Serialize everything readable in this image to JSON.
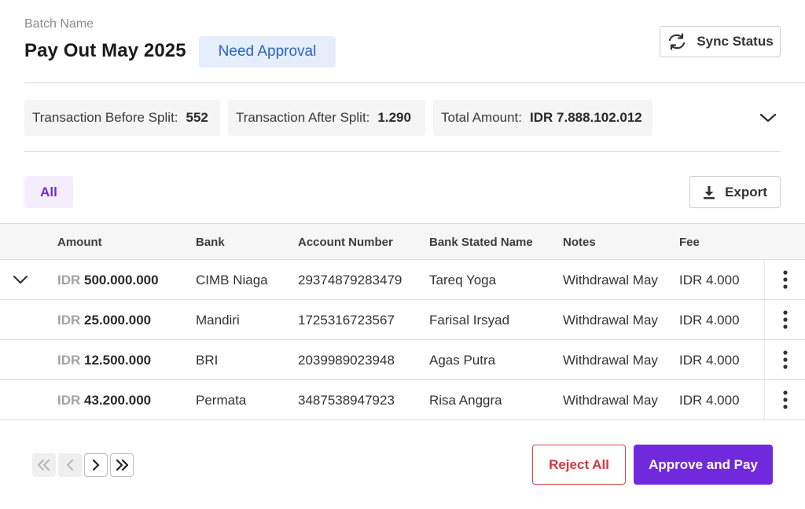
{
  "header": {
    "batch_label": "Batch Name",
    "batch_title": "Pay Out May 2025",
    "status": "Need Approval",
    "sync_label": "Sync Status"
  },
  "summary": {
    "before_label": "Transaction Before Split:",
    "before_value": "552",
    "after_label": "Transaction After Split:",
    "after_value": "1.290",
    "total_label": "Total Amount:",
    "total_value": "IDR 7.888.102.012"
  },
  "filters": {
    "all_label": "All",
    "export_label": "Export"
  },
  "table": {
    "columns": [
      "Amount",
      "Bank",
      "Account Number",
      "Bank Stated Name",
      "Notes",
      "Fee"
    ],
    "rows": [
      {
        "currency": "IDR",
        "amount": "500.000.000",
        "bank": "CIMB Niaga",
        "account": "29374879283479",
        "name": "Tareq Yoga",
        "notes": "Withdrawal May",
        "fee": "IDR 4.000"
      },
      {
        "currency": "IDR",
        "amount": "25.000.000",
        "bank": "Mandiri",
        "account": "1725316723567",
        "name": "Farisal Irsyad",
        "notes": "Withdrawal May",
        "fee": "IDR 4.000"
      },
      {
        "currency": "IDR",
        "amount": "12.500.000",
        "bank": "BRI",
        "account": "2039989023948",
        "name": "Agas Putra",
        "notes": "Withdrawal May",
        "fee": "IDR 4.000"
      },
      {
        "currency": "IDR",
        "amount": "43.200.000",
        "bank": "Permata",
        "account": "3487538947923",
        "name": "Risa Anggra",
        "notes": "Withdrawal May",
        "fee": "IDR 4.000"
      }
    ]
  },
  "footer": {
    "reject_label": "Reject All",
    "approve_label": "Approve and Pay"
  },
  "colors": {
    "accent": "#7129dd",
    "status_bg": "#e6eefb",
    "status_text": "#2a62c9",
    "danger": "#d2363e"
  },
  "icons": {
    "sync": "sync-icon",
    "export": "download-icon",
    "expand": "chevron-down-icon",
    "row_menu": "kebab-menu-icon",
    "first_page": "chevrons-left-icon",
    "prev_page": "chevron-left-icon",
    "next_page": "chevron-right-icon",
    "last_page": "chevrons-right-icon"
  }
}
